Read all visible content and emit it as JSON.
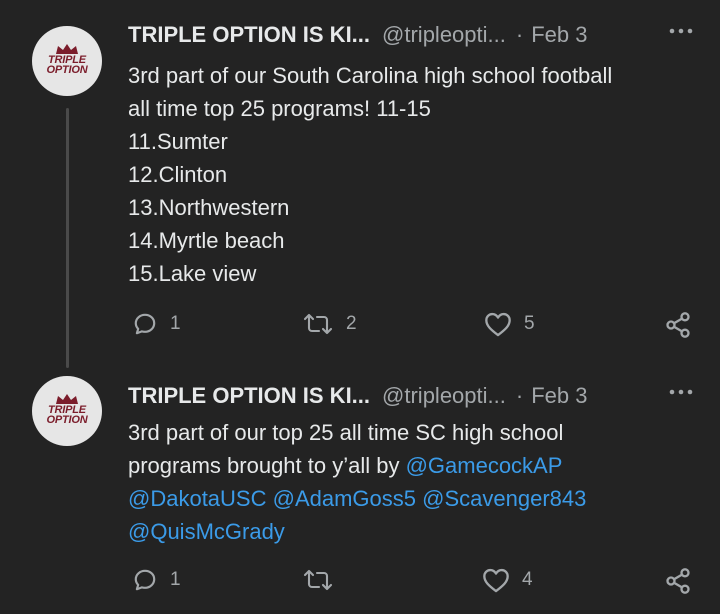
{
  "tweets": [
    {
      "avatar": {
        "line1": "TRIPLE",
        "line2": "OPTION"
      },
      "name": "TRIPLE OPTION IS KI...",
      "handle": "@tripleopti...",
      "separator": "·",
      "date": "Feb 3",
      "text_lines": [
        "3rd part of our South Carolina high school football",
        "all time top 25 programs! 11-15",
        "11.Sumter",
        "12.Clinton",
        "13.Northwestern",
        "14.Myrtle beach",
        "15.Lake view"
      ],
      "stats": {
        "replies": "1",
        "retweets": "2",
        "likes": "5"
      }
    },
    {
      "avatar": {
        "line1": "TRIPLE",
        "line2": "OPTION"
      },
      "name": "TRIPLE OPTION IS KI...",
      "handle": "@tripleopti...",
      "separator": "·",
      "date": "Feb 3",
      "text_parts": {
        "line1": "3rd part of our top 25 all time SC high school",
        "line2_plain": "programs brought to y’all by ",
        "mention1": "@GamecockAP",
        "mention2": "@DakotaUSC",
        "mention3": "@AdamGoss5",
        "mention4": "@Scavenger843",
        "mention5": "@QuisMcGrady"
      },
      "stats": {
        "replies": "1",
        "retweets": "",
        "likes": "4"
      }
    }
  ],
  "icons": {
    "reply": "reply-icon",
    "retweet": "retweet-icon",
    "like": "heart-icon",
    "share": "share-icon",
    "more": "more-icon"
  },
  "colors": {
    "background": "#232323",
    "text": "#e7e9ea",
    "secondary": "#a3a7aa",
    "mention": "#3b9be8",
    "avatar_logo": "#7b1d2b"
  }
}
